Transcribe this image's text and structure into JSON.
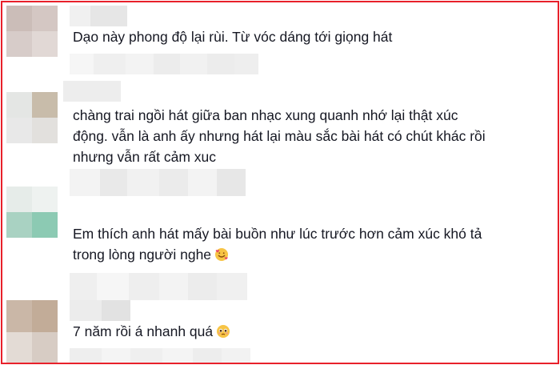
{
  "comments": [
    {
      "text": "Dạo này phong độ lại rùi. Từ vóc dáng tới giọng hát"
    },
    {
      "lines": [
        "chàng trai ngồi hát giữa ban nhạc xung quanh nhớ lại thật xúc",
        "động. vẫn là anh ấy nhưng hát lại màu sắc bài hát có chút khác rồi",
        "nhưng vẫn rất cảm xuc"
      ]
    },
    {
      "lines": [
        "Em thích anh hát mấy bài buồn như lúc trước hơn cảm xúc khó tả",
        "trong lòng người nghe"
      ],
      "emoji": "smiling-face-with-hearts-emoji"
    },
    {
      "text": "7 năm rồi á nhanh quá",
      "emoji": "pleading-face-emoji"
    }
  ],
  "colors": {
    "frame_border": "#e8202a",
    "text": "#161823"
  }
}
